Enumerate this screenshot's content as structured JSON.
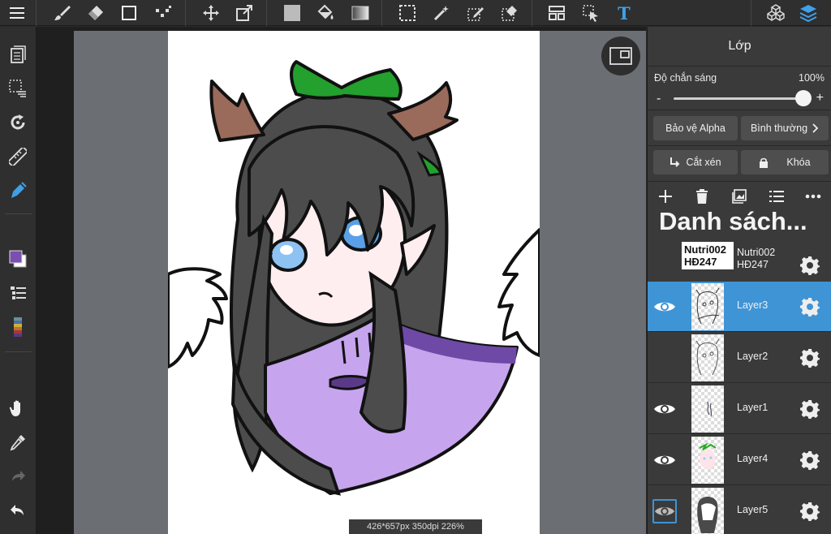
{
  "colors": {
    "accent": "#3f94d6",
    "panel": "#3a3a3a",
    "toolbar": "#2f2f2f",
    "primary_color": "#7b4fb0",
    "text_tool": "#3fa0e8"
  },
  "toolbar": {
    "icons": [
      "menu-icon",
      "brush-icon",
      "eraser-icon",
      "rectangle-icon",
      "dots-icon",
      "move-icon",
      "transform-icon",
      "fill-color-icon",
      "bucket-icon",
      "gradient-icon",
      "selection-icon",
      "magic-wand-icon",
      "select-pen-icon",
      "select-eraser-icon",
      "frame-divide-icon",
      "operation-icon",
      "text-tool-icon",
      "3d-icon",
      "layers-icon"
    ],
    "text_tool_label": "T"
  },
  "left_tools": {
    "icons": [
      "page-icon",
      "select-dots-icon",
      "rotate-icon",
      "ruler-icon",
      "pen-icon",
      "color-swatch-icon",
      "layer-list-icon",
      "palette-icon",
      "hand-icon",
      "eyedropper-icon",
      "redo-icon",
      "undo-icon"
    ]
  },
  "canvas": {
    "status": "426*657px 350dpi 226%"
  },
  "panel": {
    "title": "Lớp",
    "opacity_label": "Độ chắn sáng",
    "opacity_value": "100%",
    "opacity_level": 1.0,
    "minus": "-",
    "plus": "+",
    "alpha_protect": "Bảo vệ Alpha",
    "blend_mode": "Bình thường",
    "clipping": "Cắt xén",
    "lock": "Khóa",
    "list_title": "Danh sách...",
    "layers": [
      {
        "name": "Nutri002 HĐ247",
        "tile": "Nutri002\nHĐ247",
        "visible": false,
        "active": false
      },
      {
        "name": "Layer3",
        "visible": true,
        "active": true
      },
      {
        "name": "Layer2",
        "visible": false,
        "active": false
      },
      {
        "name": "Layer1",
        "visible": true,
        "active": false
      },
      {
        "name": "Layer4",
        "visible": true,
        "active": false
      },
      {
        "name": "Layer5",
        "visible": true,
        "active": false
      }
    ]
  }
}
